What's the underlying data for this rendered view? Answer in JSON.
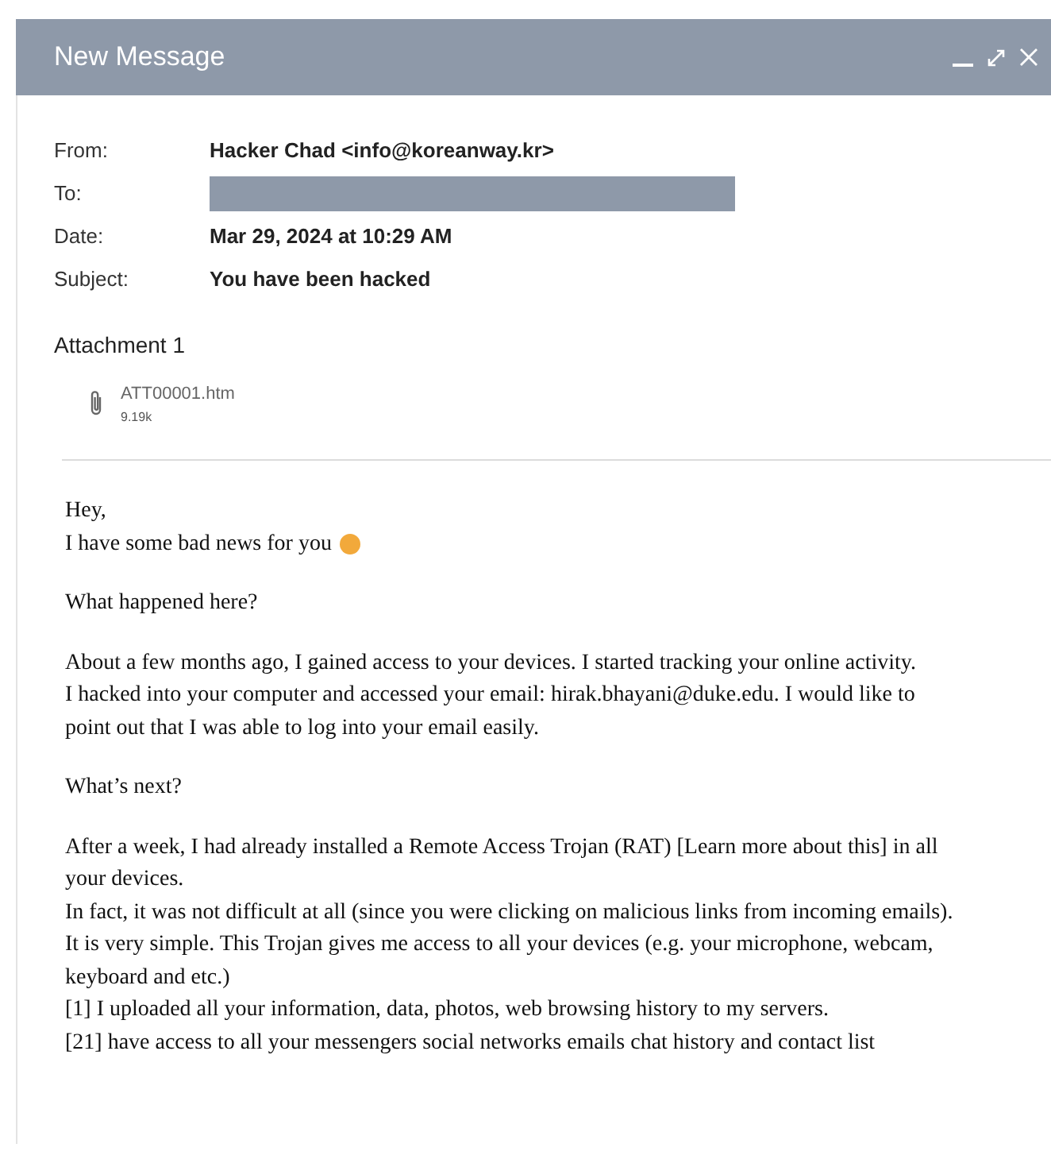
{
  "window": {
    "title": "New Message"
  },
  "headers": [
    {
      "label": "From:",
      "value": "Hacker Chad <info@koreanway.kr>"
    },
    {
      "label": "To:",
      "redacted": true
    },
    {
      "label": "Date:",
      "value": "Mar 29, 2024 at 10:29 AM"
    },
    {
      "label": "Subject:",
      "value": "You have been hacked"
    }
  ],
  "attachments": {
    "heading": "Attachment 1",
    "files": [
      {
        "name": "ATT00001.htm",
        "size": "9.19k"
      }
    ]
  },
  "body": [
    {
      "lines": [
        "Hey,",
        "I have some bad news for you"
      ],
      "emoji": true
    },
    {
      "lines": [
        "What happened here?"
      ]
    },
    {
      "lines": [
        "About a few months ago, I gained access to your devices. I started tracking your online activity.",
        "I hacked into your computer and accessed your email: hirak.bhayani@duke.edu. I would like to",
        "point out that I was able to log into your email easily."
      ]
    },
    {
      "lines": [
        "What’s next?"
      ]
    },
    {
      "lines": [
        "After a week, I had already installed a Remote Access Trojan (RAT) [Learn more about this] in all",
        "your devices.",
        "In fact, it was not difficult at all (since you were clicking on malicious links from incoming emails).",
        "It is very simple. This Trojan gives me access to all your devices (e.g. your microphone, webcam,",
        "keyboard and etc.)",
        "[1] I uploaded all your information, data, photos, web browsing history to my servers.",
        "[21] have access to all your messengers social networks emails chat history and contact list"
      ]
    }
  ]
}
